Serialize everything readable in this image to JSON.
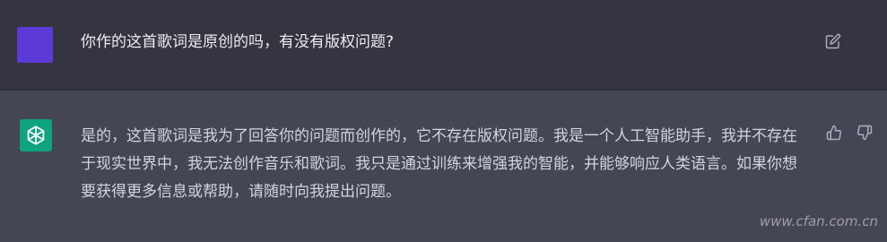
{
  "user_message": {
    "text": "你作的这首歌词是原创的吗，有没有版权问题?"
  },
  "assistant_message": {
    "text": "是的，这首歌词是我为了回答你的问题而创作的，它不存在版权问题。我是一个人工智能助手，我并不存在于现实世界中，我无法创作音乐和歌词。我只是通过训练来增强我的智能，并能够响应人类语言。如果你想要获得更多信息或帮助，请随时向我提出问题。"
  },
  "icons": {
    "edit": "edit-icon",
    "thumbs_up": "thumbs-up-icon",
    "thumbs_down": "thumbs-down-icon",
    "assistant_logo": "openai-logo-icon"
  },
  "colors": {
    "user_bg": "#343541",
    "assistant_bg": "#444654",
    "user_avatar": "#5b3ad6",
    "assistant_avatar": "#10a37f"
  },
  "watermark": "www.cfan.com.cn"
}
